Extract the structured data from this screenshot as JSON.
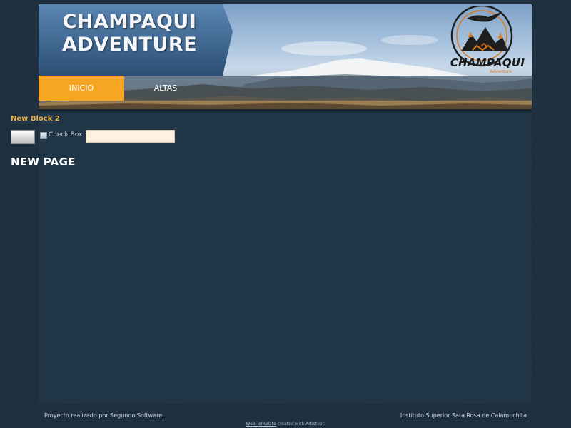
{
  "header": {
    "title_line1": "CHAMPAQUI",
    "title_line2": "ADVENTURE",
    "logo": {
      "icon": "condor-mountain-logo-icon",
      "wordmark": "CHAMPAQUI",
      "subtitle": "Adventure",
      "accent_color": "#e07a1a"
    }
  },
  "nav": {
    "items": [
      {
        "label": "INICIO",
        "active": true
      },
      {
        "label": "ALTAS",
        "active": false
      }
    ],
    "active_color": "#f7a623"
  },
  "content": {
    "block_title": "New Block 2",
    "checkbox_label": "Check Box",
    "text_input_value": "",
    "page_heading": "NEW PAGE"
  },
  "footer": {
    "left_text": "Proyecto realizado por Segundo Software.",
    "right_text": "Instituto Superior Sata Rosa de Calamuchita",
    "credit_link": "Web Template",
    "credit_text": "created with Artisteer."
  }
}
